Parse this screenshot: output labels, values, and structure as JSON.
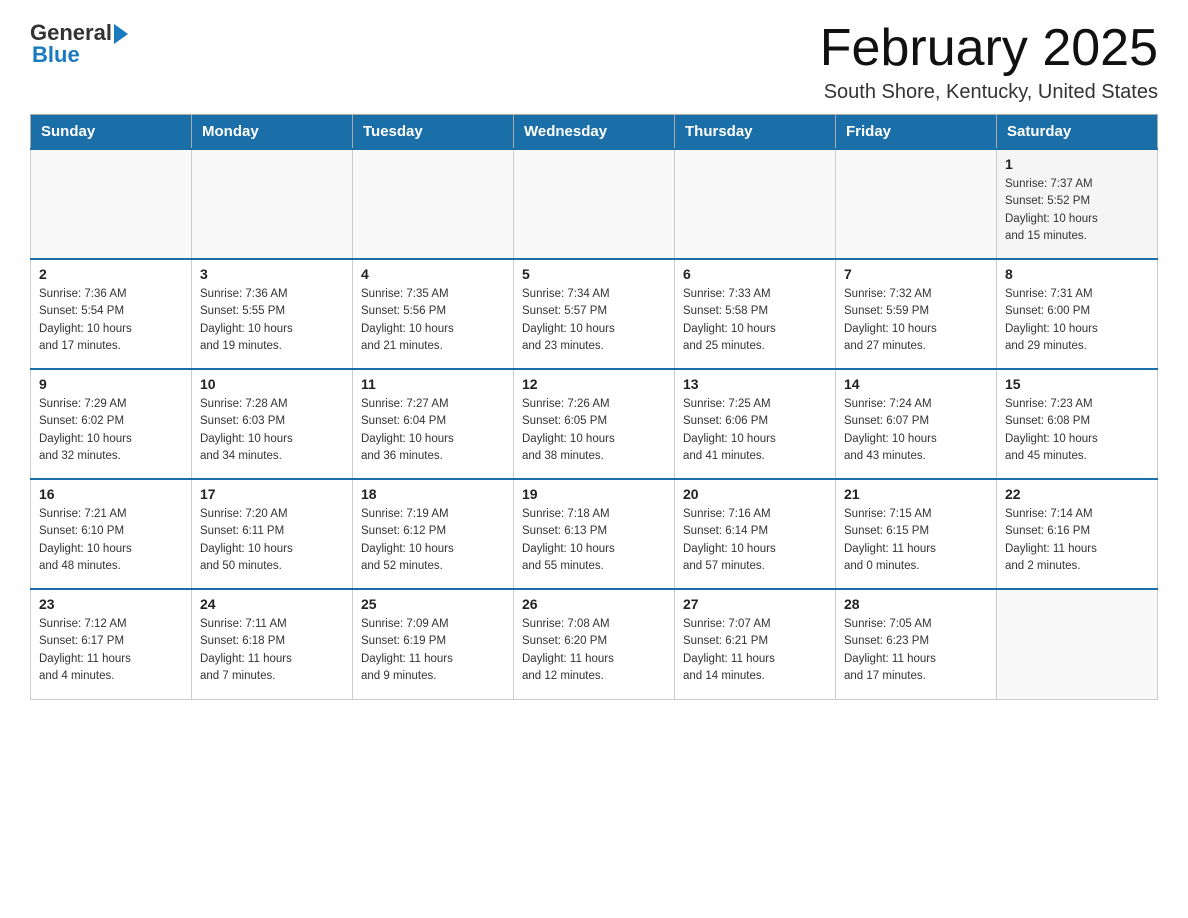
{
  "logo": {
    "general_text": "General",
    "blue_text": "Blue"
  },
  "header": {
    "month_year": "February 2025",
    "location": "South Shore, Kentucky, United States"
  },
  "weekdays": [
    "Sunday",
    "Monday",
    "Tuesday",
    "Wednesday",
    "Thursday",
    "Friday",
    "Saturday"
  ],
  "weeks": [
    [
      {
        "day": "",
        "info": ""
      },
      {
        "day": "",
        "info": ""
      },
      {
        "day": "",
        "info": ""
      },
      {
        "day": "",
        "info": ""
      },
      {
        "day": "",
        "info": ""
      },
      {
        "day": "",
        "info": ""
      },
      {
        "day": "1",
        "info": "Sunrise: 7:37 AM\nSunset: 5:52 PM\nDaylight: 10 hours\nand 15 minutes."
      }
    ],
    [
      {
        "day": "2",
        "info": "Sunrise: 7:36 AM\nSunset: 5:54 PM\nDaylight: 10 hours\nand 17 minutes."
      },
      {
        "day": "3",
        "info": "Sunrise: 7:36 AM\nSunset: 5:55 PM\nDaylight: 10 hours\nand 19 minutes."
      },
      {
        "day": "4",
        "info": "Sunrise: 7:35 AM\nSunset: 5:56 PM\nDaylight: 10 hours\nand 21 minutes."
      },
      {
        "day": "5",
        "info": "Sunrise: 7:34 AM\nSunset: 5:57 PM\nDaylight: 10 hours\nand 23 minutes."
      },
      {
        "day": "6",
        "info": "Sunrise: 7:33 AM\nSunset: 5:58 PM\nDaylight: 10 hours\nand 25 minutes."
      },
      {
        "day": "7",
        "info": "Sunrise: 7:32 AM\nSunset: 5:59 PM\nDaylight: 10 hours\nand 27 minutes."
      },
      {
        "day": "8",
        "info": "Sunrise: 7:31 AM\nSunset: 6:00 PM\nDaylight: 10 hours\nand 29 minutes."
      }
    ],
    [
      {
        "day": "9",
        "info": "Sunrise: 7:29 AM\nSunset: 6:02 PM\nDaylight: 10 hours\nand 32 minutes."
      },
      {
        "day": "10",
        "info": "Sunrise: 7:28 AM\nSunset: 6:03 PM\nDaylight: 10 hours\nand 34 minutes."
      },
      {
        "day": "11",
        "info": "Sunrise: 7:27 AM\nSunset: 6:04 PM\nDaylight: 10 hours\nand 36 minutes."
      },
      {
        "day": "12",
        "info": "Sunrise: 7:26 AM\nSunset: 6:05 PM\nDaylight: 10 hours\nand 38 minutes."
      },
      {
        "day": "13",
        "info": "Sunrise: 7:25 AM\nSunset: 6:06 PM\nDaylight: 10 hours\nand 41 minutes."
      },
      {
        "day": "14",
        "info": "Sunrise: 7:24 AM\nSunset: 6:07 PM\nDaylight: 10 hours\nand 43 minutes."
      },
      {
        "day": "15",
        "info": "Sunrise: 7:23 AM\nSunset: 6:08 PM\nDaylight: 10 hours\nand 45 minutes."
      }
    ],
    [
      {
        "day": "16",
        "info": "Sunrise: 7:21 AM\nSunset: 6:10 PM\nDaylight: 10 hours\nand 48 minutes."
      },
      {
        "day": "17",
        "info": "Sunrise: 7:20 AM\nSunset: 6:11 PM\nDaylight: 10 hours\nand 50 minutes."
      },
      {
        "day": "18",
        "info": "Sunrise: 7:19 AM\nSunset: 6:12 PM\nDaylight: 10 hours\nand 52 minutes."
      },
      {
        "day": "19",
        "info": "Sunrise: 7:18 AM\nSunset: 6:13 PM\nDaylight: 10 hours\nand 55 minutes."
      },
      {
        "day": "20",
        "info": "Sunrise: 7:16 AM\nSunset: 6:14 PM\nDaylight: 10 hours\nand 57 minutes."
      },
      {
        "day": "21",
        "info": "Sunrise: 7:15 AM\nSunset: 6:15 PM\nDaylight: 11 hours\nand 0 minutes."
      },
      {
        "day": "22",
        "info": "Sunrise: 7:14 AM\nSunset: 6:16 PM\nDaylight: 11 hours\nand 2 minutes."
      }
    ],
    [
      {
        "day": "23",
        "info": "Sunrise: 7:12 AM\nSunset: 6:17 PM\nDaylight: 11 hours\nand 4 minutes."
      },
      {
        "day": "24",
        "info": "Sunrise: 7:11 AM\nSunset: 6:18 PM\nDaylight: 11 hours\nand 7 minutes."
      },
      {
        "day": "25",
        "info": "Sunrise: 7:09 AM\nSunset: 6:19 PM\nDaylight: 11 hours\nand 9 minutes."
      },
      {
        "day": "26",
        "info": "Sunrise: 7:08 AM\nSunset: 6:20 PM\nDaylight: 11 hours\nand 12 minutes."
      },
      {
        "day": "27",
        "info": "Sunrise: 7:07 AM\nSunset: 6:21 PM\nDaylight: 11 hours\nand 14 minutes."
      },
      {
        "day": "28",
        "info": "Sunrise: 7:05 AM\nSunset: 6:23 PM\nDaylight: 11 hours\nand 17 minutes."
      },
      {
        "day": "",
        "info": ""
      }
    ]
  ]
}
